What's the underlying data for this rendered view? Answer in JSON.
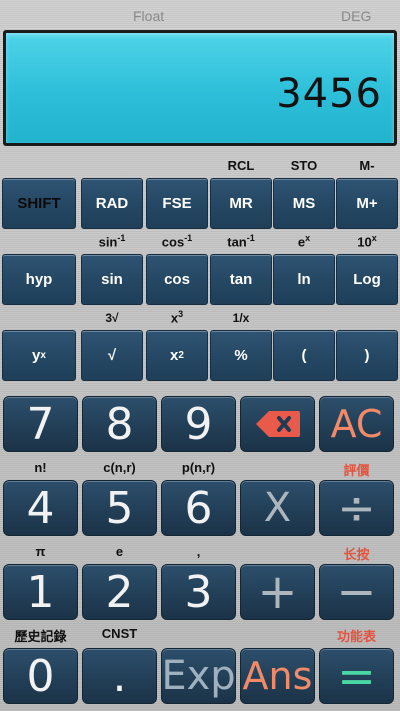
{
  "status": {
    "mode": "Float",
    "angle": "DEG"
  },
  "display": {
    "value": "3456"
  },
  "row1_labels": [
    "",
    "",
    "",
    "RCL",
    "STO",
    "M-"
  ],
  "row1": [
    "SHIFT",
    "RAD",
    "FSE",
    "MR",
    "MS",
    "M+"
  ],
  "row2_labels": [
    "",
    "sin-1",
    "cos-1",
    "tan-1",
    "ex",
    "10x"
  ],
  "row2": [
    "hyp",
    "sin",
    "cos",
    "tan",
    "ln",
    "Log"
  ],
  "row3_labels": [
    "",
    "3√",
    "x3",
    "1/x",
    "",
    ""
  ],
  "row3": [
    "yx",
    "√",
    "x2",
    "%",
    "(",
    ")"
  ],
  "keys": {
    "seven": "7",
    "eight": "8",
    "nine": "9",
    "ac": "AC",
    "four": "4",
    "five": "5",
    "six": "6",
    "multiply": "X",
    "divide": "÷",
    "one": "1",
    "two": "2",
    "three": "3",
    "plus": "+",
    "minus": "−",
    "zero": "0",
    "dot": ".",
    "exp": "Exp",
    "ans": "Ans",
    "equals": "="
  },
  "big_labels_row2": [
    "n!",
    "c(n,r)",
    "p(n,r)",
    "",
    "評價"
  ],
  "big_labels_row3": [
    "π",
    "e",
    ",",
    "",
    "长按"
  ],
  "big_labels_row4": [
    "歷史記錄",
    "CNST",
    "",
    "",
    "功能表"
  ],
  "colors": {
    "display_bg": "#2dbfd9",
    "key_bg": "#223f57",
    "accent_orange": "#f08a68",
    "accent_green": "#4bd7a4",
    "accent_red": "#e2543f"
  },
  "icons": {
    "backspace": "backspace-icon"
  }
}
